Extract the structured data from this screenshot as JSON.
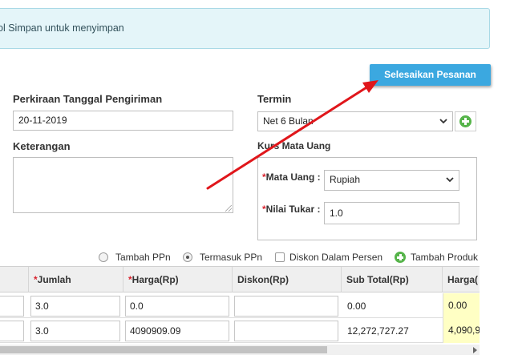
{
  "notice": {
    "text": "ol Simpan untuk menyimpan"
  },
  "actions": {
    "finish_order": "Selesaikan Pesanan"
  },
  "form": {
    "delivery_date": {
      "label": "Perkiraan Tanggal Pengiriman",
      "value": "20-11-2019"
    },
    "term": {
      "label": "Termin",
      "value": "Net 6 Bulan"
    },
    "note": {
      "label": "Keterangan",
      "value": ""
    },
    "currency_section": {
      "label": "Kurs Mata Uang",
      "currency": {
        "required_mark": "*",
        "label": "Mata Uang :",
        "value": "Rupiah"
      },
      "exchange_rate": {
        "required_mark": "*",
        "label": "Nilai Tukar :",
        "value": "1.0"
      }
    }
  },
  "tax_options": {
    "add_ppn": "Tambah PPn",
    "include_ppn": "Termasuk PPn",
    "selected": "Termasuk PPn",
    "discount_percent": "Diskon Dalam Persen",
    "add_product": "Tambah Produk"
  },
  "table": {
    "headers": [
      {
        "required_mark": "",
        "label": ""
      },
      {
        "required_mark": "*",
        "label": "Jumlah"
      },
      {
        "required_mark": "*",
        "label": "Harga(Rp)"
      },
      {
        "required_mark": "",
        "label": "Diskon(Rp)"
      },
      {
        "required_mark": "",
        "label": "Sub Total(Rp)"
      },
      {
        "required_mark": "",
        "label": "Harga("
      }
    ],
    "rows": [
      {
        "qty": "3.0",
        "price": "0.0",
        "discount": "",
        "subtotal": "0.00",
        "price2": "0.00"
      },
      {
        "qty": "3.0",
        "price": "4090909.09",
        "discount": "",
        "subtotal": "12,272,727.27",
        "price2": "4,090,9"
      }
    ]
  },
  "colors": {
    "accent": "#3ba8e0",
    "annotation_arrow": "#e0161b",
    "add_icon": "#56b44a",
    "highlight_cell": "#ffffc4"
  }
}
